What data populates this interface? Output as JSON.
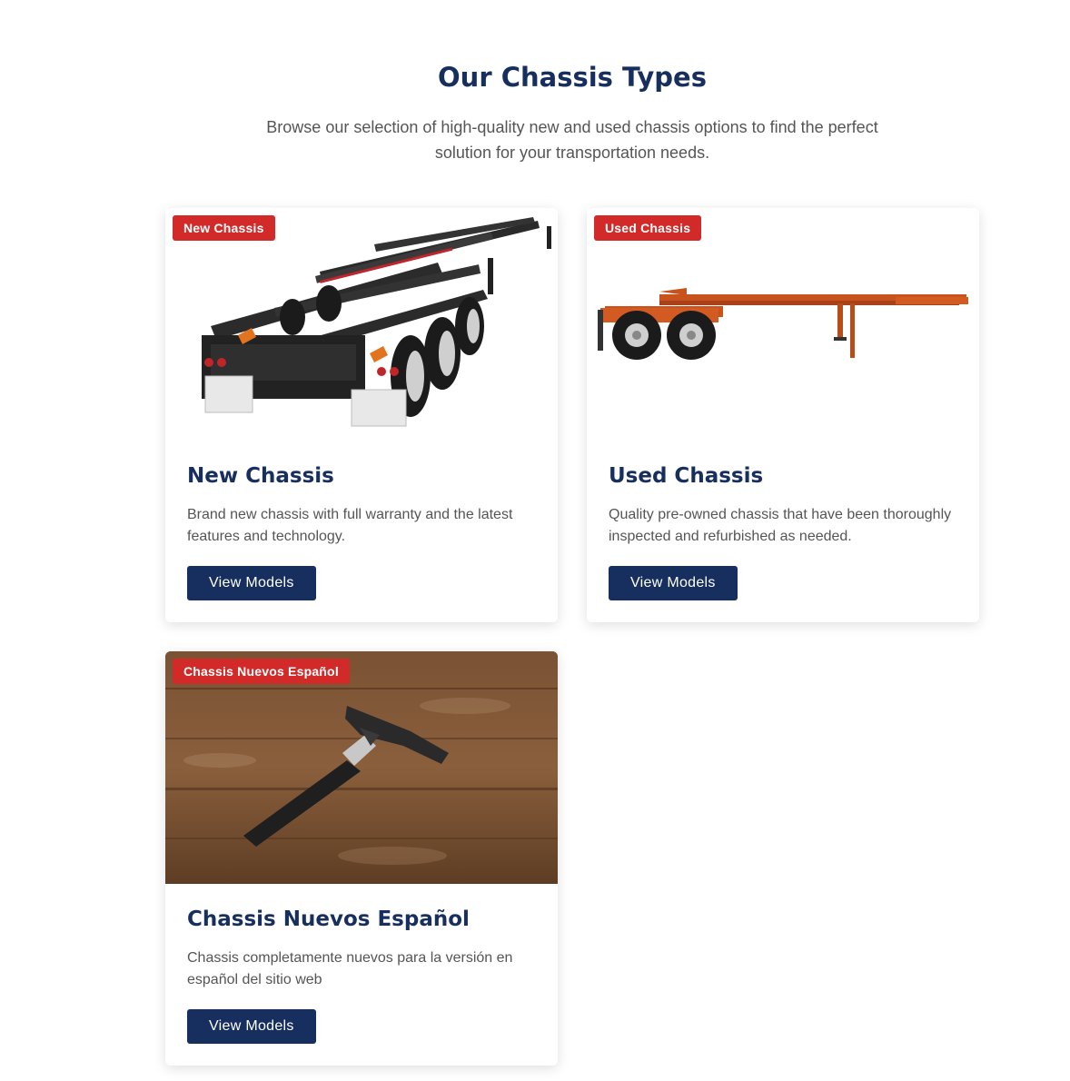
{
  "section": {
    "title": "Our Chassis Types",
    "subtitle": "Browse our selection of high-quality new and used chassis options to find the perfect solution for your transportation needs."
  },
  "cards": [
    {
      "badge": "New Chassis",
      "title": "New Chassis",
      "description": "Brand new chassis with full warranty and the latest features and technology.",
      "button": "View Models",
      "image": "black-tri-axle-chassis-image"
    },
    {
      "badge": "Used Chassis",
      "title": "Used Chassis",
      "description": "Quality pre-owned chassis that have been thoroughly inspected and refurbished as needed.",
      "button": "View Models",
      "image": "orange-tandem-chassis-image"
    },
    {
      "badge": "Chassis Nuevos Español",
      "title": "Chassis Nuevos Español",
      "description": "Chassis completamente nuevos para la versión en español del sitio web",
      "button": "View Models",
      "image": "hammer-on-wood-image"
    }
  ],
  "colors": {
    "heading": "#172f5f",
    "badge": "#d22a28",
    "button": "#172f5f"
  }
}
